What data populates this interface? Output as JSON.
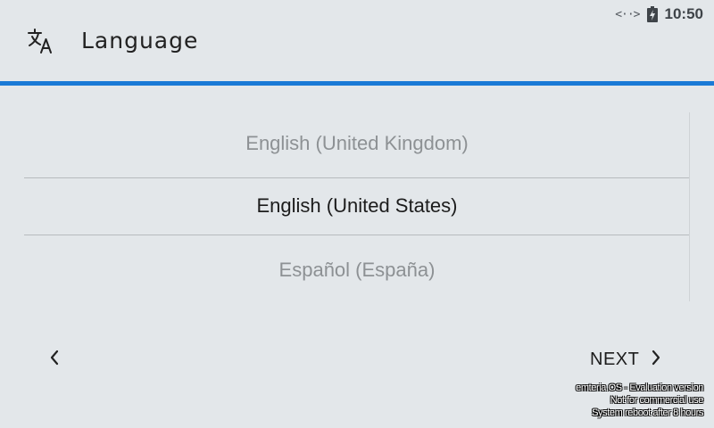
{
  "status_bar": {
    "network_icon": "network-activity-icon",
    "network_glyph": "<··>",
    "battery_icon": "battery-charging-icon",
    "clock": "10:50"
  },
  "header": {
    "icon": "translate-icon",
    "title": "Language"
  },
  "colors": {
    "accent": "#1a7ad6",
    "background": "#e3e7ea",
    "selected_text": "#1c1c1c",
    "unselected_text": "#8d9194"
  },
  "language_picker": {
    "items": [
      {
        "label": "English (United Kingdom)",
        "selected": false
      },
      {
        "label": "English (United States)",
        "selected": true
      },
      {
        "label": "Español (España)",
        "selected": false
      }
    ]
  },
  "navigation": {
    "back_icon": "chevron-left-icon",
    "next_label": "NEXT",
    "next_icon": "chevron-right-icon"
  },
  "watermark": {
    "line1": "emteria.OS - Evaluation version",
    "line2": "Not for commercial use",
    "line3": "System reboot after 8 hours"
  }
}
